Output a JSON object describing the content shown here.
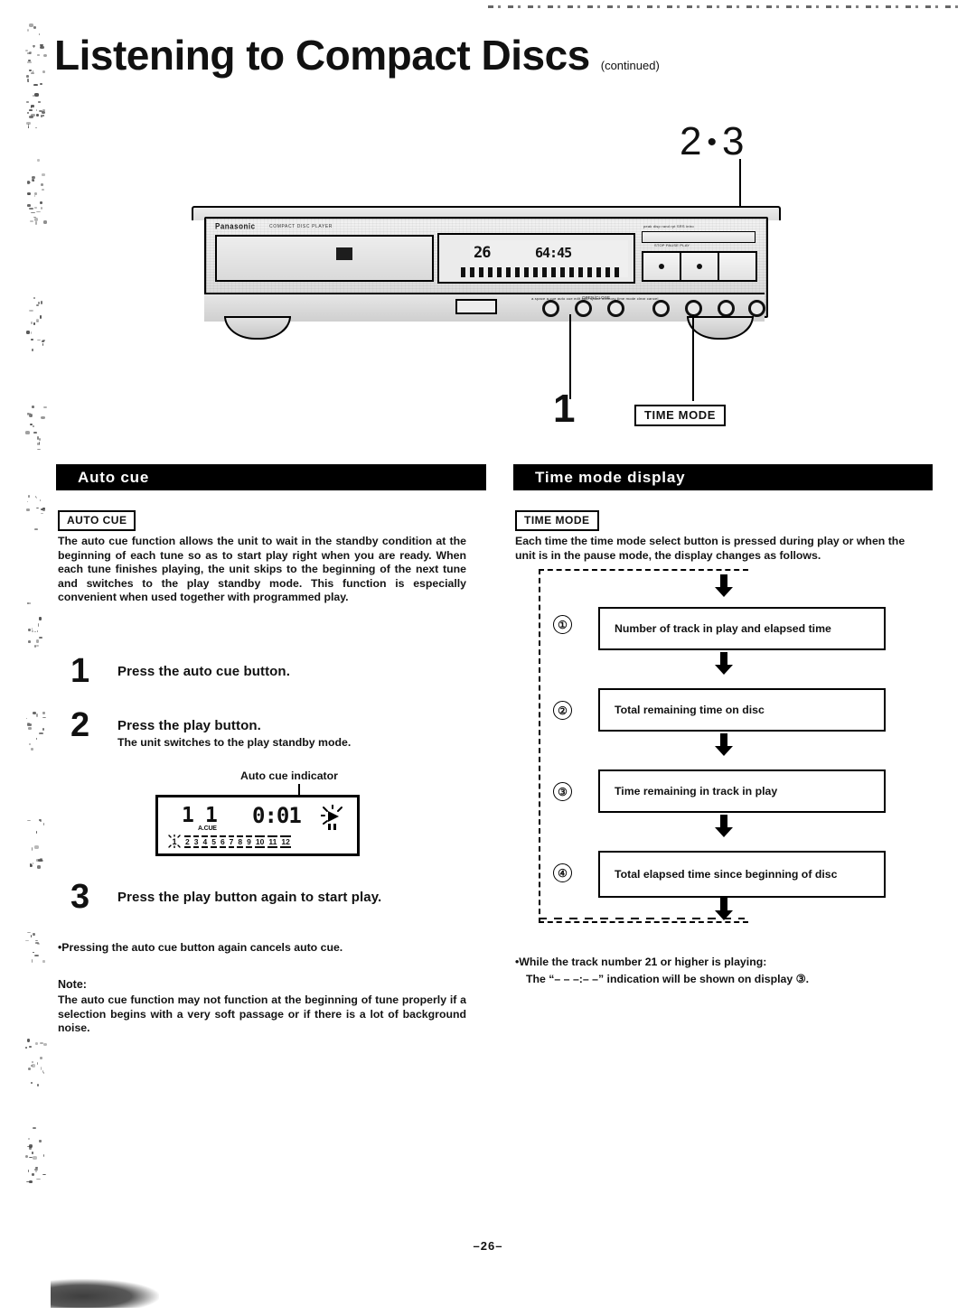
{
  "page": {
    "title": "Listening to Compact Discs",
    "title_suffix": "(continued)",
    "page_number": "–26–"
  },
  "diagram": {
    "callout_23": "2",
    "callout_23_dot": "•",
    "callout_23_b": "3",
    "callout_1": "1",
    "time_mode_label": "TIME MODE",
    "player": {
      "brand": "Panasonic",
      "brand_sub": "COMPACT DISC PLAYER",
      "display_track": "26",
      "display_time": "64:45",
      "open_close_label": "OPEN/CLOSE",
      "top_button_labels": "peak  disp  rand    rpt  SRS  intro",
      "transport_labels": "STOP     PAUSE       PLAY",
      "front_button_labels": "a.space  a.cue  auto cue  edit  split  space    memory  time mode  clear  cancel"
    }
  },
  "left_column": {
    "section_header": "Auto cue",
    "button_chip": "AUTO CUE",
    "intro": "The auto cue function allows the unit to wait in the standby condition at the beginning of each tune so as to start play right when you are ready. When each tune finishes playing, the unit skips to the beginning of the next  tune and switches to the play standby mode. This function is especially convenient when used together with programmed play.",
    "steps": [
      {
        "num": "1",
        "text": "Press the auto cue button.",
        "sub": ""
      },
      {
        "num": "2",
        "text": "Press the play button.",
        "sub": "The unit switches to the play standby mode."
      },
      {
        "num": "3",
        "text": "Press the play button again to start play.",
        "sub": ""
      }
    ],
    "lcd_caption": "Auto cue indicator",
    "lcd": {
      "track_digit_1": "1",
      "track_digit_2": "1",
      "acue_label": "A.CUE",
      "time": "0:01",
      "track_numbers": [
        "1",
        "2",
        "3",
        "4",
        "5",
        "6",
        "7",
        "8",
        "9",
        "10",
        "11",
        "12"
      ],
      "flashing_track": "1"
    },
    "bullet": "•Pressing the auto cue button again cancels auto cue.",
    "note_heading": "Note:",
    "note_body": "The auto cue function may not function at the beginning of tune properly if a selection begins with a very soft passage or if there is a lot of background noise."
  },
  "right_column": {
    "section_header": "Time mode display",
    "button_chip": "TIME MODE",
    "intro": "Each time the time mode select button is pressed during play or when the unit is in the pause mode, the display changes as follows.",
    "flow_steps": [
      {
        "num": "①",
        "text": "Number of track in play and elapsed time"
      },
      {
        "num": "②",
        "text": "Total remaining time on disc"
      },
      {
        "num": "③",
        "text": "Time remaining in track in play"
      },
      {
        "num": "④",
        "text": "Total elapsed time since beginning of disc"
      }
    ],
    "bullet_heading": "•While the track number 21 or higher is playing:",
    "bullet_body": "The “– – –:– –” indication will be shown on display ③."
  }
}
